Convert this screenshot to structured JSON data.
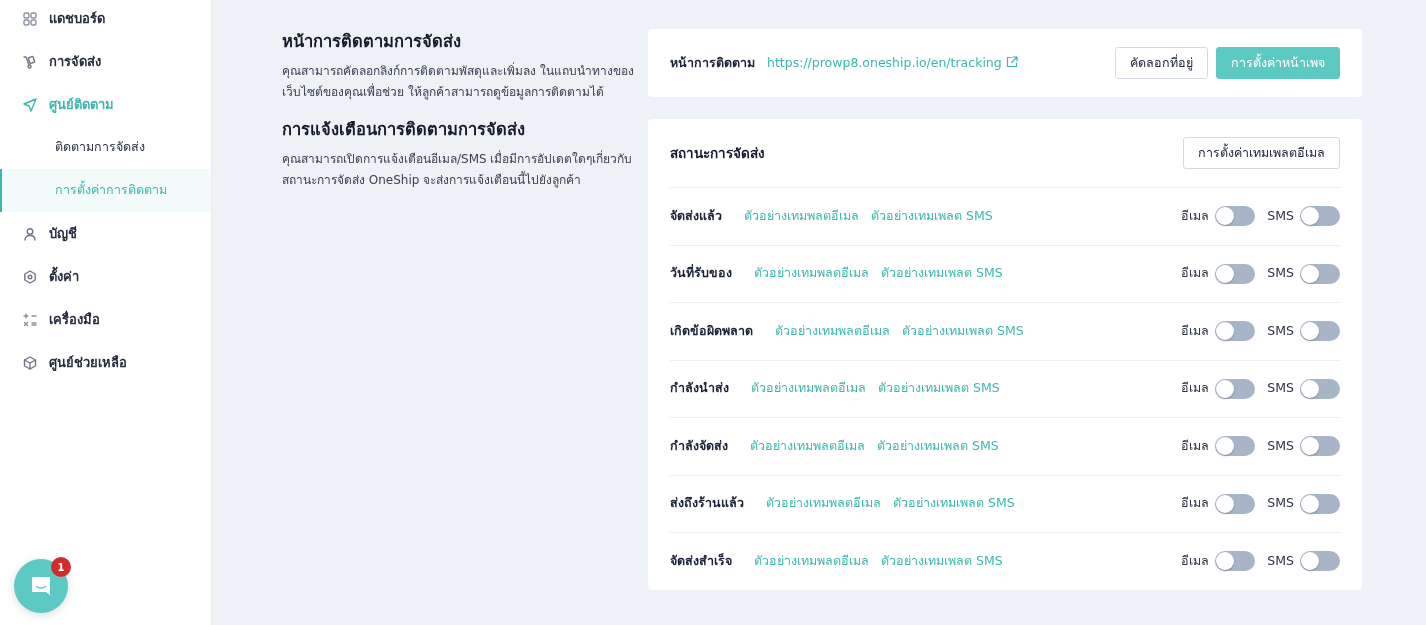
{
  "sidebar": {
    "items": [
      {
        "label": "แดชบอร์ด",
        "selected": false
      },
      {
        "label": "การจัดส่ง",
        "selected": false
      },
      {
        "label": "ศูนย์ติดตาม",
        "selected": true,
        "children": [
          {
            "label": "ติดตามการจัดส่ง",
            "selected": false
          },
          {
            "label": "การตั้งค่าการติดตาม",
            "selected": true
          }
        ]
      },
      {
        "label": "บัญชี",
        "selected": false
      },
      {
        "label": "ตั้งค่า",
        "selected": false
      },
      {
        "label": "เครื่องมือ",
        "selected": false
      },
      {
        "label": "ศูนย์ช่วยเหลือ",
        "selected": false
      }
    ]
  },
  "sections": [
    {
      "title": "หน้าการติดตามการจัดส่ง",
      "description": "คุณสามารถคัดลอกลิงก์การติดตามพัสดุและเพิ่มลง ในแถบนำทางของเว็บไซต์ของคุณเพื่อช่วย ให้ลูกค้าสามารถดูข้อมูลการติดตามได้"
    },
    {
      "title": "การแจ้งเตือนการติดตามการจัดส่ง",
      "description": "คุณสามารถเปิดการแจ้งเตือนอีเมล/SMS เมื่อมีการอัปเดตใดๆเกี่ยวกับสถานะการจัดส่ง OneShip จะส่งการแจ้งเตือนนี้ไปยังลูกค้า"
    }
  ],
  "tracking_page_card": {
    "label": "หน้าการติดตาม",
    "url": "https://prowp8.oneship.io/en/tracking",
    "buttons": [
      {
        "label": "คัดลอกที่อยู่",
        "kind": "outline"
      },
      {
        "label": "การตั้งค่าหน้าเพจ",
        "kind": "primary"
      }
    ]
  },
  "status_card": {
    "title": "สถานะการจัดส่ง",
    "button": "การตั้งค่าเทมเพลตอีเมล",
    "rows": [
      {
        "status": "จัดส่งแล้ว",
        "email_template_link": "ตัวอย่างเทมพลตอีเมล",
        "sms_template_link": "ตัวอย่างเทมเพลต SMS",
        "email_label": "อีเมล",
        "email_on": false,
        "sms_label": "SMS",
        "sms_on": false
      },
      {
        "status": "วันที่รับของ",
        "email_template_link": "ตัวอย่างเทมพลตอีเมล",
        "sms_template_link": "ตัวอย่างเทมเพลต SMS",
        "email_label": "อีเมล",
        "email_on": false,
        "sms_label": "SMS",
        "sms_on": false
      },
      {
        "status": "เกิดข้อผิดพลาด",
        "email_template_link": "ตัวอย่างเทมพลตอีเมล",
        "sms_template_link": "ตัวอย่างเทมเพลต SMS",
        "email_label": "อีเมล",
        "email_on": false,
        "sms_label": "SMS",
        "sms_on": false
      },
      {
        "status": "กำลังนำส่ง",
        "email_template_link": "ตัวอย่างเทมพลตอีเมล",
        "sms_template_link": "ตัวอย่างเทมเพลต SMS",
        "email_label": "อีเมล",
        "email_on": false,
        "sms_label": "SMS",
        "sms_on": false
      },
      {
        "status": "กำลังจัดส่ง",
        "email_template_link": "ตัวอย่างเทมพลตอีเมล",
        "sms_template_link": "ตัวอย่างเทมเพลต SMS",
        "email_label": "อีเมล",
        "email_on": false,
        "sms_label": "SMS",
        "sms_on": false
      },
      {
        "status": "ส่งถึงร้านแล้ว",
        "email_template_link": "ตัวอย่างเทมพลตอีเมล",
        "sms_template_link": "ตัวอย่างเทมเพลต SMS",
        "email_label": "อีเมล",
        "email_on": false,
        "sms_label": "SMS",
        "sms_on": false
      },
      {
        "status": "จัดส่งสำเร็จ",
        "email_template_link": "ตัวอย่างเทมพลตอีเมล",
        "sms_template_link": "ตัวอย่างเทมเพลต SMS",
        "email_label": "อีเมล",
        "email_on": false,
        "sms_label": "SMS",
        "sms_on": false
      }
    ]
  },
  "chat_widget": {
    "badge": "1"
  }
}
